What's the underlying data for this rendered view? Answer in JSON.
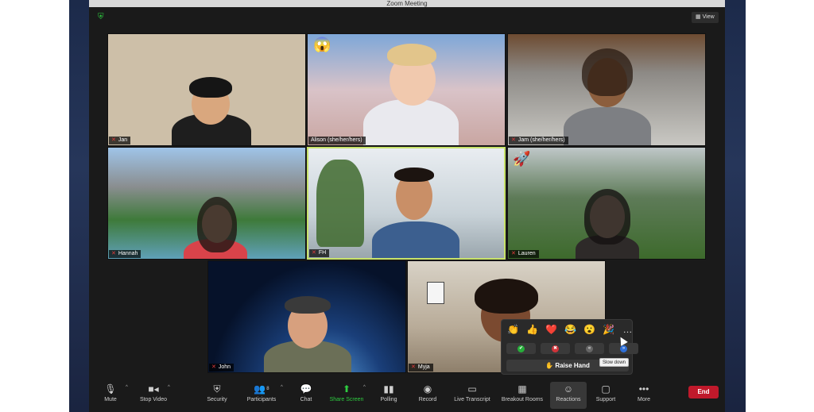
{
  "window": {
    "title": "Zoom Meeting",
    "view_label": "View"
  },
  "colors": {
    "accent_green": "#2ecc40",
    "end_red": "#c0192b",
    "active_border": "#c7e26a"
  },
  "participants": [
    {
      "name": "Jan",
      "muted": true
    },
    {
      "name": "Alison (she/her/hers)",
      "muted": false,
      "reaction": "😱"
    },
    {
      "name": "Jam (she/her/hers)",
      "muted": true
    },
    {
      "name": "Hannah",
      "muted": true
    },
    {
      "name": "FH",
      "muted": true,
      "active_speaker": true
    },
    {
      "name": "Lauren",
      "muted": true,
      "reaction": "🚀"
    },
    {
      "name": "John",
      "muted": true
    },
    {
      "name": "Myja",
      "muted": true
    }
  ],
  "reactions": {
    "emojis": [
      "👏",
      "👍",
      "❤️",
      "😂",
      "😮",
      "🎉",
      "…"
    ],
    "feedback": [
      {
        "icon": "check-icon",
        "color": "#27ae3a",
        "glyph": "✔"
      },
      {
        "icon": "x-icon",
        "color": "#d0343a",
        "glyph": "✖"
      },
      {
        "icon": "rewind-icon",
        "color": "#666666",
        "glyph": "«"
      },
      {
        "icon": "fast-forward-icon",
        "color": "#2e6fd8",
        "glyph": "»"
      }
    ],
    "raise_hand_label": "Raise Hand",
    "raise_hand_icon": "✋",
    "tooltip": "Slow down"
  },
  "toolbar": {
    "mute": "Mute",
    "stop_video": "Stop Video",
    "security": "Security",
    "participants": "Participants",
    "participants_count": "8",
    "chat": "Chat",
    "share_screen": "Share Screen",
    "polling": "Polling",
    "record": "Record",
    "live_transcript": "Live Transcript",
    "breakout_rooms": "Breakout Rooms",
    "reactions": "Reactions",
    "support": "Support",
    "more": "More",
    "end": "End"
  }
}
